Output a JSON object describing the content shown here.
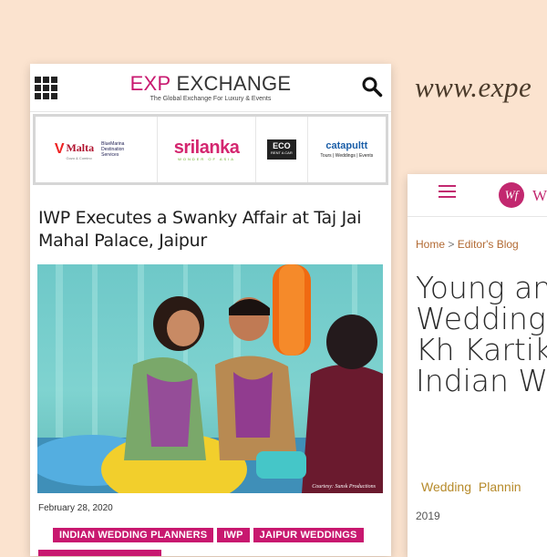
{
  "url_text": "www.expe",
  "left_site": {
    "logo_accent": "EXP",
    "logo_main": "EXCHANGE",
    "logo_tagline": "The Global Exchange For Luxury & Events",
    "sponsors": {
      "malta": "Malta",
      "malta_sub": "Gozo & Comino",
      "bluemarine": "BlueMarina Destination Services",
      "srilanka": "srilanka",
      "srilanka_sub": "WONDER OF ASIA",
      "eco": "ECO",
      "eco_sub": "RENT A CAR",
      "catapultt": "catapultt",
      "catapultt_sub": "Tours | Weddings | Events"
    },
    "article": {
      "title": "IWP Executes a Swanky Affair at Taj Jai Mahal Palace, Jaipur",
      "date": "February 28, 2020",
      "photo_credit": "Courtesy: Sunsk Productions",
      "tags": [
        "INDIAN WEDDING PLANNERS",
        "IWP",
        "JAIPUR WEDDINGS"
      ]
    }
  },
  "right_site": {
    "logo_letter": "W",
    "logo_monogram": "Wf",
    "breadcrumb": {
      "home": "Home",
      "separator": ">",
      "section": "Editor's Blog"
    },
    "title": "Young an Wedding Anant Kh Kartika S Indian W Planners",
    "categories": "Wedding Plannin",
    "year": "2019"
  },
  "colors": {
    "brand_magenta": "#c8186f",
    "background": "#fbe3cf"
  }
}
